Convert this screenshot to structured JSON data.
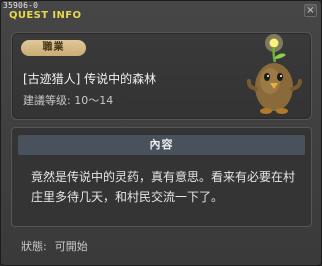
{
  "window": {
    "quest_id": "35906-0",
    "title": "QUEST INFO",
    "close_glyph": "×"
  },
  "summary": {
    "job_label": "職業",
    "quest_name": "[古迹猎人] 传说中的森林",
    "level_label": "建議等级:",
    "level_range": "10～14",
    "npc_icon": "potato-npc-sprout-icon"
  },
  "content": {
    "header": "內容",
    "text": "竟然是传说中的灵药，真有意思。看来有必要在村庄里多待几天，和村民交流一下了。"
  },
  "status": {
    "label": "狀態:",
    "value": "可開始"
  },
  "colors": {
    "title": "#e7d74e",
    "badge": "#d6bb86",
    "header_bar": "#49525c"
  }
}
